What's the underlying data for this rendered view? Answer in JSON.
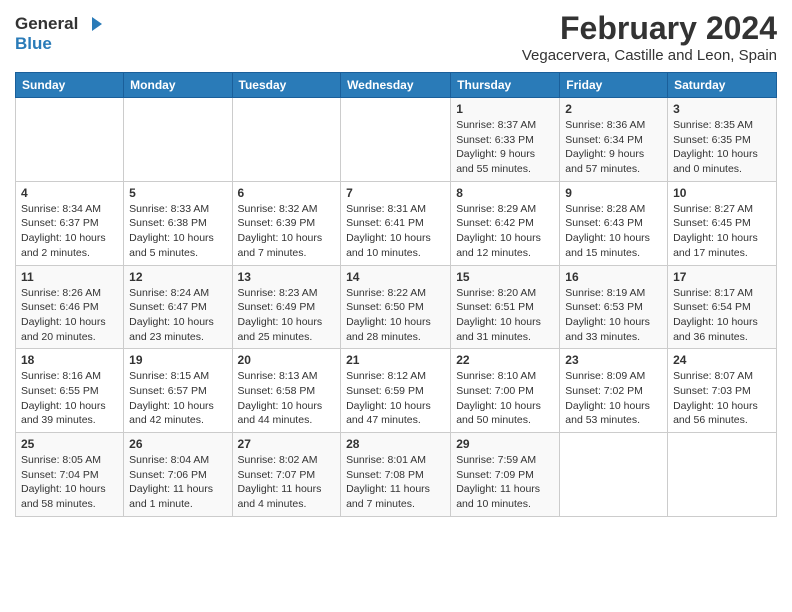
{
  "header": {
    "logo_general": "General",
    "logo_blue": "Blue",
    "month_year": "February 2024",
    "location": "Vegacervera, Castille and Leon, Spain"
  },
  "weekdays": [
    "Sunday",
    "Monday",
    "Tuesday",
    "Wednesday",
    "Thursday",
    "Friday",
    "Saturday"
  ],
  "weeks": [
    [
      {
        "day": "",
        "info": ""
      },
      {
        "day": "",
        "info": ""
      },
      {
        "day": "",
        "info": ""
      },
      {
        "day": "",
        "info": ""
      },
      {
        "day": "1",
        "info": "Sunrise: 8:37 AM\nSunset: 6:33 PM\nDaylight: 9 hours\nand 55 minutes."
      },
      {
        "day": "2",
        "info": "Sunrise: 8:36 AM\nSunset: 6:34 PM\nDaylight: 9 hours\nand 57 minutes."
      },
      {
        "day": "3",
        "info": "Sunrise: 8:35 AM\nSunset: 6:35 PM\nDaylight: 10 hours\nand 0 minutes."
      }
    ],
    [
      {
        "day": "4",
        "info": "Sunrise: 8:34 AM\nSunset: 6:37 PM\nDaylight: 10 hours\nand 2 minutes."
      },
      {
        "day": "5",
        "info": "Sunrise: 8:33 AM\nSunset: 6:38 PM\nDaylight: 10 hours\nand 5 minutes."
      },
      {
        "day": "6",
        "info": "Sunrise: 8:32 AM\nSunset: 6:39 PM\nDaylight: 10 hours\nand 7 minutes."
      },
      {
        "day": "7",
        "info": "Sunrise: 8:31 AM\nSunset: 6:41 PM\nDaylight: 10 hours\nand 10 minutes."
      },
      {
        "day": "8",
        "info": "Sunrise: 8:29 AM\nSunset: 6:42 PM\nDaylight: 10 hours\nand 12 minutes."
      },
      {
        "day": "9",
        "info": "Sunrise: 8:28 AM\nSunset: 6:43 PM\nDaylight: 10 hours\nand 15 minutes."
      },
      {
        "day": "10",
        "info": "Sunrise: 8:27 AM\nSunset: 6:45 PM\nDaylight: 10 hours\nand 17 minutes."
      }
    ],
    [
      {
        "day": "11",
        "info": "Sunrise: 8:26 AM\nSunset: 6:46 PM\nDaylight: 10 hours\nand 20 minutes."
      },
      {
        "day": "12",
        "info": "Sunrise: 8:24 AM\nSunset: 6:47 PM\nDaylight: 10 hours\nand 23 minutes."
      },
      {
        "day": "13",
        "info": "Sunrise: 8:23 AM\nSunset: 6:49 PM\nDaylight: 10 hours\nand 25 minutes."
      },
      {
        "day": "14",
        "info": "Sunrise: 8:22 AM\nSunset: 6:50 PM\nDaylight: 10 hours\nand 28 minutes."
      },
      {
        "day": "15",
        "info": "Sunrise: 8:20 AM\nSunset: 6:51 PM\nDaylight: 10 hours\nand 31 minutes."
      },
      {
        "day": "16",
        "info": "Sunrise: 8:19 AM\nSunset: 6:53 PM\nDaylight: 10 hours\nand 33 minutes."
      },
      {
        "day": "17",
        "info": "Sunrise: 8:17 AM\nSunset: 6:54 PM\nDaylight: 10 hours\nand 36 minutes."
      }
    ],
    [
      {
        "day": "18",
        "info": "Sunrise: 8:16 AM\nSunset: 6:55 PM\nDaylight: 10 hours\nand 39 minutes."
      },
      {
        "day": "19",
        "info": "Sunrise: 8:15 AM\nSunset: 6:57 PM\nDaylight: 10 hours\nand 42 minutes."
      },
      {
        "day": "20",
        "info": "Sunrise: 8:13 AM\nSunset: 6:58 PM\nDaylight: 10 hours\nand 44 minutes."
      },
      {
        "day": "21",
        "info": "Sunrise: 8:12 AM\nSunset: 6:59 PM\nDaylight: 10 hours\nand 47 minutes."
      },
      {
        "day": "22",
        "info": "Sunrise: 8:10 AM\nSunset: 7:00 PM\nDaylight: 10 hours\nand 50 minutes."
      },
      {
        "day": "23",
        "info": "Sunrise: 8:09 AM\nSunset: 7:02 PM\nDaylight: 10 hours\nand 53 minutes."
      },
      {
        "day": "24",
        "info": "Sunrise: 8:07 AM\nSunset: 7:03 PM\nDaylight: 10 hours\nand 56 minutes."
      }
    ],
    [
      {
        "day": "25",
        "info": "Sunrise: 8:05 AM\nSunset: 7:04 PM\nDaylight: 10 hours\nand 58 minutes."
      },
      {
        "day": "26",
        "info": "Sunrise: 8:04 AM\nSunset: 7:06 PM\nDaylight: 11 hours\nand 1 minute."
      },
      {
        "day": "27",
        "info": "Sunrise: 8:02 AM\nSunset: 7:07 PM\nDaylight: 11 hours\nand 4 minutes."
      },
      {
        "day": "28",
        "info": "Sunrise: 8:01 AM\nSunset: 7:08 PM\nDaylight: 11 hours\nand 7 minutes."
      },
      {
        "day": "29",
        "info": "Sunrise: 7:59 AM\nSunset: 7:09 PM\nDaylight: 11 hours\nand 10 minutes."
      },
      {
        "day": "",
        "info": ""
      },
      {
        "day": "",
        "info": ""
      }
    ]
  ]
}
